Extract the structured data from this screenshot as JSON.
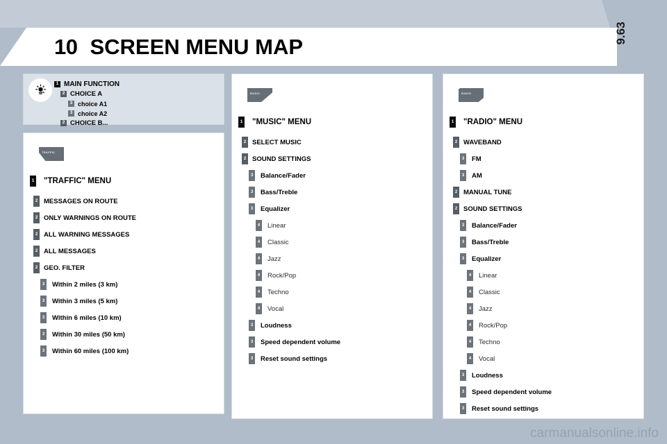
{
  "header": {
    "chapter_number": "10",
    "title": "SCREEN MENU MAP",
    "page_number": "9.63"
  },
  "legend": {
    "icon": "sun-bulb-icon",
    "rows": [
      {
        "level": 1,
        "label": "MAIN FUNCTION"
      },
      {
        "level": 2,
        "label": "CHOICE A"
      },
      {
        "level": 3,
        "label": "choice A1"
      },
      {
        "level": 3,
        "label": "choice A2"
      },
      {
        "level": 2,
        "label": "CHOICE B..."
      }
    ]
  },
  "columns": [
    {
      "id": "traffic",
      "icon_glyph": "TRAFFIC",
      "icon_shape": "slanted-left",
      "rows": [
        {
          "level": 1,
          "label": "\"TRAFFIC\" MENU"
        },
        {
          "level": 2,
          "label": "MESSAGES ON ROUTE"
        },
        {
          "level": 2,
          "label": "ONLY WARNINGS ON ROUTE"
        },
        {
          "level": 2,
          "label": "ALL WARNING MESSAGES"
        },
        {
          "level": 2,
          "label": "ALL MESSAGES"
        },
        {
          "level": 2,
          "label": "GEO. FILTER"
        },
        {
          "level": 3,
          "label": "Within 2 miles (3 km)"
        },
        {
          "level": 3,
          "label": "Within 3 miles (5 km)"
        },
        {
          "level": 3,
          "label": "Within 6 miles (10 km)"
        },
        {
          "level": 3,
          "label": "Within 30 miles (50 km)"
        },
        {
          "level": 3,
          "label": "Within 60 miles (100 km)"
        }
      ]
    },
    {
      "id": "music",
      "icon_glyph": "MUSIC",
      "icon_shape": "slanted",
      "rows": [
        {
          "level": 1,
          "label": "\"MUSIC\" MENU"
        },
        {
          "level": 2,
          "label": "SELECT MUSIC"
        },
        {
          "level": 2,
          "label": "SOUND SETTINGS"
        },
        {
          "level": 3,
          "label": "Balance/Fader"
        },
        {
          "level": 3,
          "label": "Bass/Treble"
        },
        {
          "level": 3,
          "label": "Equalizer"
        },
        {
          "level": 4,
          "label": "Linear"
        },
        {
          "level": 4,
          "label": "Classic"
        },
        {
          "level": 4,
          "label": "Jazz"
        },
        {
          "level": 4,
          "label": "Rock/Pop"
        },
        {
          "level": 4,
          "label": "Techno"
        },
        {
          "level": 4,
          "label": "Vocal"
        },
        {
          "level": 3,
          "label": "Loudness"
        },
        {
          "level": 3,
          "label": "Speed dependent volume"
        },
        {
          "level": 3,
          "label": "Reset sound settings"
        }
      ]
    },
    {
      "id": "radio",
      "icon_glyph": "RADIO",
      "icon_shape": "rounded",
      "rows": [
        {
          "level": 1,
          "label": "\"RADIO\" MENU"
        },
        {
          "level": 2,
          "label": "WAVEBAND"
        },
        {
          "level": 3,
          "label": "FM"
        },
        {
          "level": 3,
          "label": "AM"
        },
        {
          "level": 2,
          "label": "MANUAL TUNE"
        },
        {
          "level": 2,
          "label": "SOUND SETTINGS"
        },
        {
          "level": 3,
          "label": "Balance/Fader"
        },
        {
          "level": 3,
          "label": "Bass/Treble"
        },
        {
          "level": 3,
          "label": "Equalizer"
        },
        {
          "level": 4,
          "label": "Linear"
        },
        {
          "level": 4,
          "label": "Classic"
        },
        {
          "level": 4,
          "label": "Jazz"
        },
        {
          "level": 4,
          "label": "Rock/Pop"
        },
        {
          "level": 4,
          "label": "Techno"
        },
        {
          "level": 4,
          "label": "Vocal"
        },
        {
          "level": 3,
          "label": "Loudness"
        },
        {
          "level": 3,
          "label": "Speed dependent volume"
        },
        {
          "level": 3,
          "label": "Reset sound settings"
        }
      ]
    }
  ],
  "watermark": "carmanualsonline.info",
  "colors": {
    "page_background": "#b0bcc9",
    "band": "#c3ccd6",
    "banner": "#ffffff",
    "legend_panel": "#dbe1e8",
    "badge_level1": "#0d0d0d",
    "badge_level2": "#565e66",
    "badge_level3": "#6b737b",
    "icon_gray": "#666e76",
    "watermark_color": "#95a3b2"
  }
}
